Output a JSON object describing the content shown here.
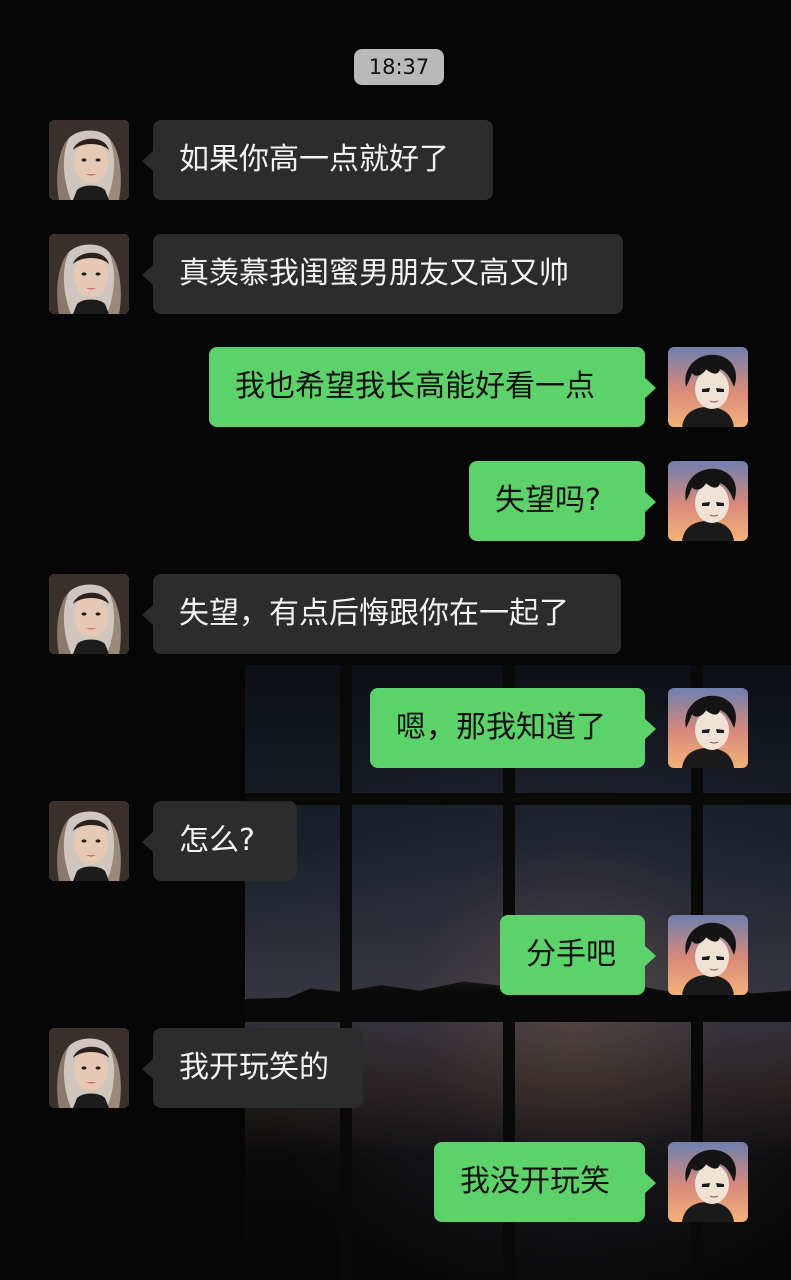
{
  "chat": {
    "timestamp": "18:37",
    "messages": [
      {
        "side": "in",
        "text": "如果你高一点就好了"
      },
      {
        "side": "in",
        "text": "真羡慕我闺蜜男朋友又高又帅"
      },
      {
        "side": "out",
        "text": "我也希望我长高能好看一点"
      },
      {
        "side": "out",
        "text": "失望吗?"
      },
      {
        "side": "in",
        "text": "失望，有点后悔跟你在一起了"
      },
      {
        "side": "out",
        "text": "嗯，那我知道了"
      },
      {
        "side": "in",
        "text": "怎么?"
      },
      {
        "side": "out",
        "text": "分手吧"
      },
      {
        "side": "in",
        "text": "我开玩笑的"
      },
      {
        "side": "out",
        "text": "我没开玩笑"
      }
    ]
  },
  "colors": {
    "incoming_bubble": "#2c2c2c",
    "outgoing_bubble": "#5ed26a",
    "background": "#060606"
  },
  "icons": {
    "contact_avatar": "girl-avatar-icon",
    "self_avatar": "anime-boy-avatar-icon"
  }
}
